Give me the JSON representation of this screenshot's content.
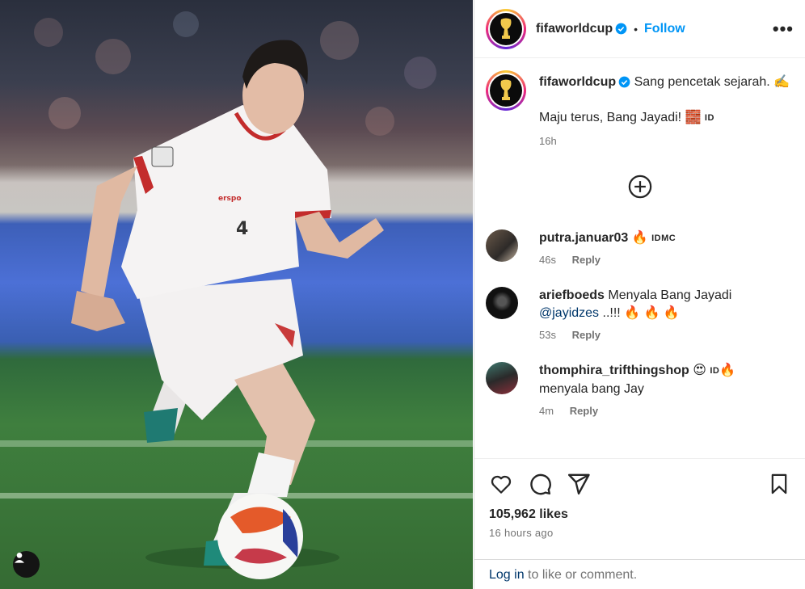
{
  "post": {
    "username": "fifaworldcup",
    "follow_label": "Follow",
    "separator": "•",
    "more_label": "•••",
    "caption_text": "Sang pencetak sejarah. ✍️",
    "caption_line2": "Maju terus, Bang Jayadi! 🧱",
    "caption_flag": "ID",
    "caption_time": "16h"
  },
  "comments": [
    {
      "username": "putra.januar03",
      "text": "🔥",
      "flag": "IDMC",
      "time": "46s",
      "reply_label": "Reply"
    },
    {
      "username": "ariefboeds",
      "text": "Menyala Bang Jayadi",
      "mention": "@jayidzes",
      "text_after": " ..!!! 🔥 🔥 🔥",
      "time": "53s",
      "reply_label": "Reply"
    },
    {
      "username": "thomphira_trifthingshop",
      "emoji": "😍",
      "flag": "ID",
      "emoji2": "🔥",
      "text": "menyala bang Jay",
      "time": "4m",
      "reply_label": "Reply"
    }
  ],
  "engagement": {
    "likes": "105,962 likes",
    "posted_ago": "16 hours ago"
  },
  "login": {
    "link": "Log in",
    "rest": " to like or comment."
  },
  "colors": {
    "accent": "#0095f6",
    "verified": "#0095f6",
    "muted": "#737373",
    "text": "#262626",
    "link": "#00376b"
  },
  "icons": [
    "heart-icon",
    "comment-icon",
    "share-icon",
    "bookmark-icon",
    "add-circle-icon",
    "verified-icon",
    "user-tag-icon"
  ]
}
